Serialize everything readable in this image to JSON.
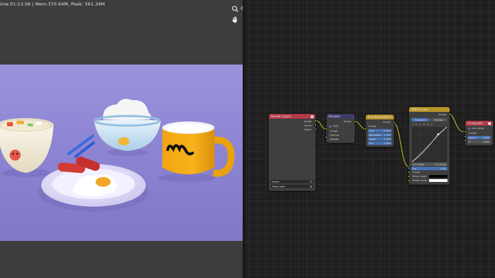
{
  "viewer": {
    "stats": "ime:01:13.06 | Mem:370.64M, Peak: 561.34M",
    "zoom_icon": "zoom-icon",
    "pan_icon": "hand-icon",
    "background": "#3d3d3d",
    "render_background": "#8f86d4"
  },
  "nodes": {
    "render_layers": {
      "title": "Render Layers",
      "color": "#b33a47",
      "outputs": [
        "Image",
        "Alpha",
        "Depth"
      ],
      "scene": "Scene",
      "layer": "View Layer"
    },
    "denoise": {
      "title": "Denoise",
      "color": "#3c3c6a",
      "output": "Image",
      "hdr_label": "HDR",
      "inputs": [
        "Image",
        "Normal",
        "Albedo"
      ]
    },
    "hue_saturation": {
      "title": "Hue Saturation Value",
      "color": "#b89326",
      "output": "Image",
      "input": "Image",
      "fields": [
        {
          "label": "Hue",
          "value": "0.500"
        },
        {
          "label": "Saturation",
          "value": "1.100"
        },
        {
          "label": "Value",
          "value": "1.000"
        },
        {
          "label": "Fac",
          "value": "1.000"
        }
      ]
    },
    "rgb_curves": {
      "title": "RGB Curves",
      "color": "#b89326",
      "output": "Image",
      "mode_tabs": [
        "Standard",
        "Filmlike"
      ],
      "fields": [
        {
          "label": "X 0.75000",
          "value": "Y 0.79225"
        }
      ],
      "fac_label": "Fac",
      "fac_value": "1.000",
      "inputs": [
        "Image",
        "Black Level",
        "White Level"
      ]
    },
    "composite": {
      "title": "Composite",
      "color": "#b33a47",
      "use_alpha": "Use Alpha",
      "input": "Image",
      "fields": [
        {
          "label": "Alpha",
          "value": "1.000"
        },
        {
          "label": "Z",
          "value": "1.000"
        }
      ]
    }
  }
}
